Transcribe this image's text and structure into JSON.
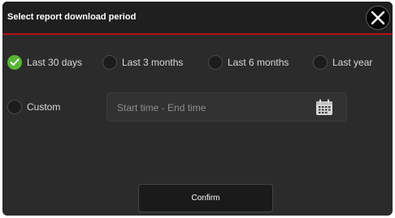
{
  "dialog": {
    "title": "Select report download period",
    "close_icon": "close-x-icon"
  },
  "periods": {
    "selected": "last_30_days",
    "options": [
      {
        "id": "last_30_days",
        "label": "Last 30 days",
        "checked": true
      },
      {
        "id": "last_3_months",
        "label": "Last 3 months",
        "checked": false
      },
      {
        "id": "last_6_months",
        "label": "Last 6 months",
        "checked": false
      },
      {
        "id": "last_year",
        "label": "Last year",
        "checked": false
      },
      {
        "id": "custom",
        "label": "Custom",
        "checked": false
      }
    ]
  },
  "custom_range": {
    "placeholder": "Start time - End time",
    "value": "",
    "icon": "calendar-icon"
  },
  "footer": {
    "confirm_label": "Confirm"
  },
  "colors": {
    "accent_check": "#57b535",
    "header_rule": "#b5121b",
    "dialog_bg": "#2b2b2b"
  }
}
